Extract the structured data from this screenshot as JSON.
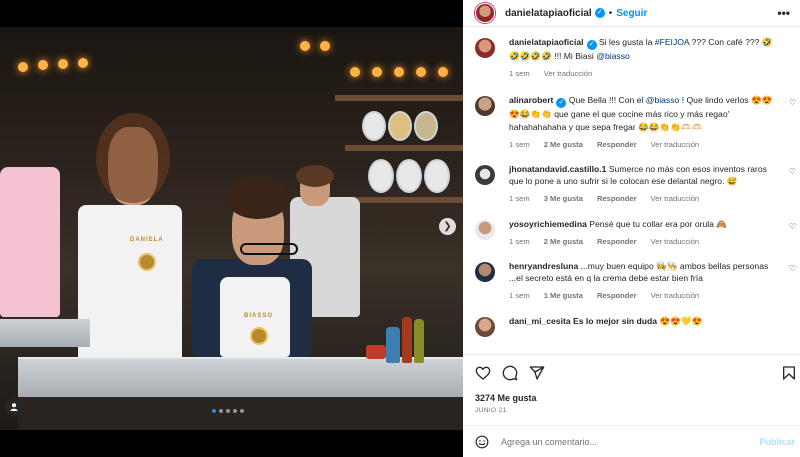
{
  "post": {
    "username": "danielatapiaoficial",
    "follow_label": "Seguir",
    "more_label": "•••"
  },
  "colors": {
    "accent": "#0095f6",
    "text": "#262626",
    "muted": "#737373",
    "mention": "#00376b"
  },
  "caption": {
    "username": "danielatapiaoficial",
    "text_line1": "Si les gusta la ",
    "hashtag": "#FEIJOA",
    "text_line1b": " ??? Con café ??? 🤣",
    "text_line2": "🤣🤣🤣🤣 !!! Mi Biasi ",
    "mention": "@biasso",
    "time": "1 sem",
    "translate": "Ver traducción"
  },
  "comments": [
    {
      "username": "alinarobert",
      "verified": true,
      "text_a": "Que Bella !!! Con el ",
      "mention": "@biasso",
      "text_b": " ! Que lindo verlos 😍😍😍😂👏👏 que gane el que cocine más rico y más regao' hahahahahaha y que sepa fregar 😂😂👏👏🫶🏻🫶🏻",
      "time": "1 sem",
      "likes": "2 Me gusta",
      "reply": "Responder",
      "translate": "Ver traducción"
    },
    {
      "username": "jhonatandavid.castillo.1",
      "verified": false,
      "text_a": "Sumerce no más con esos inventos raros que lo pone a uno sufrir si le colocan ese delantal negro. 😅",
      "mention": "",
      "text_b": "",
      "time": "1 sem",
      "likes": "3 Me gusta",
      "reply": "Responder",
      "translate": "Ver traducción"
    },
    {
      "username": "yosoyrichiemedina",
      "verified": false,
      "text_a": "Pensé que tu collar era por orula 🙈",
      "mention": "",
      "text_b": "",
      "time": "1 sem",
      "likes": "2 Me gusta",
      "reply": "Responder",
      "translate": "Ver traducción"
    },
    {
      "username": "henryandresluna",
      "verified": false,
      "text_a": "...muy buen equipo 👩‍🍳👨‍🍳 ambos bellas personas ...el secreto está en q la crema debe estar bien fría",
      "mention": "",
      "text_b": "",
      "time": "1 sem",
      "likes": "1 Me gusta",
      "reply": "Responder",
      "translate": "Ver traducción"
    },
    {
      "username": "dani_mi_cesita",
      "verified": false,
      "text_a": "Es lo mejor sin duda 😍😍💛😍",
      "mention": "",
      "text_b": "",
      "time": "",
      "likes": "",
      "reply": "",
      "translate": ""
    }
  ],
  "stats": {
    "likes": "3274 Me gusta",
    "date": "JUNIO 21"
  },
  "composer": {
    "placeholder": "Agrega un comentario...",
    "publish": "Publicar"
  },
  "photo": {
    "apron_left": "DANIELA",
    "apron_right": "BIASSO"
  },
  "carousel": {
    "count": 5,
    "active": 0
  },
  "icons": [
    "heart-icon",
    "comment-icon",
    "share-icon",
    "bookmark-icon",
    "emoji-icon",
    "more-icon",
    "verified-icon",
    "chevron-right-icon",
    "user-tag-icon"
  ]
}
